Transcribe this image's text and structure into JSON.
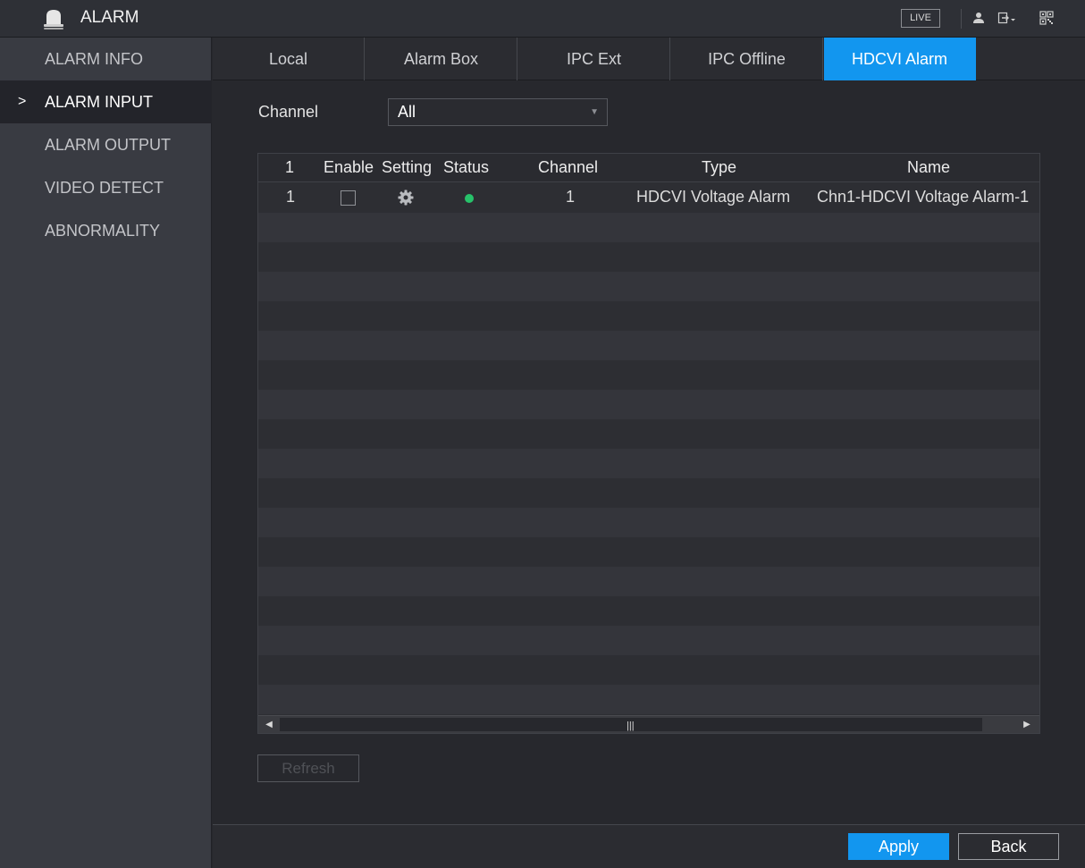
{
  "header": {
    "title": "ALARM",
    "live_label": "LIVE",
    "icons": [
      "alarm-bell-icon",
      "user-icon",
      "logout-icon",
      "qr-code-icon"
    ]
  },
  "sidebar": {
    "items": [
      {
        "label": "ALARM INFO",
        "active": false
      },
      {
        "label": "ALARM INPUT",
        "active": true
      },
      {
        "label": "ALARM OUTPUT",
        "active": false
      },
      {
        "label": "VIDEO DETECT",
        "active": false
      },
      {
        "label": "ABNORMALITY",
        "active": false
      }
    ],
    "active_marker": ">"
  },
  "tabs": [
    {
      "label": "Local",
      "active": false
    },
    {
      "label": "Alarm Box",
      "active": false
    },
    {
      "label": "IPC Ext",
      "active": false
    },
    {
      "label": "IPC Offline",
      "active": false
    },
    {
      "label": "HDCVI Alarm",
      "active": true
    }
  ],
  "filter": {
    "channel_label": "Channel",
    "channel_value": "All"
  },
  "table": {
    "columns": [
      "1",
      "Enable",
      "Setting",
      "Status",
      "Channel",
      "Type",
      "Name"
    ],
    "rows": [
      {
        "index": "1",
        "enabled": false,
        "status": "online",
        "channel": "1",
        "type": "HDCVI Voltage Alarm",
        "name": "Chn1-HDCVI Voltage Alarm-1"
      }
    ]
  },
  "buttons": {
    "refresh": "Refresh",
    "apply": "Apply",
    "back": "Back"
  },
  "colors": {
    "accent": "#1296ef",
    "status_online": "#27c26a",
    "background": "#27282d",
    "sidebar": "#393b42"
  }
}
